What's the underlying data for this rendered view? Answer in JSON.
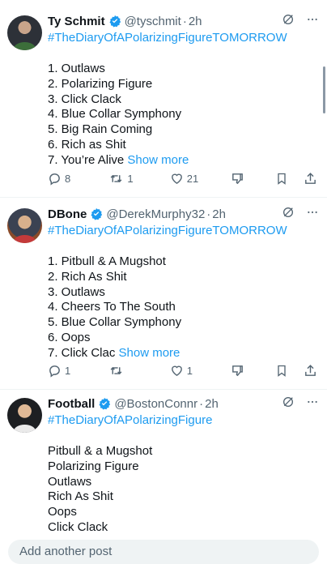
{
  "tweets": [
    {
      "name": "Ty Schmit",
      "handle": "@tyschmit",
      "time": "2h",
      "hashtag": "#TheDiaryOfAPolarizingFigureTOMORROW",
      "lines": [
        "1. Outlaws",
        "2. Polarizing Figure",
        "3. Click Clack",
        "4. Blue Collar Symphony",
        "5. Big Rain Coming",
        "6. Rich as Shit"
      ],
      "last_line": "7. You’re Alive ",
      "show_more": "Show more",
      "replies": "8",
      "retweets": "1",
      "likes": "21"
    },
    {
      "name": "DBone",
      "handle": "@DerekMurphy32",
      "time": "2h",
      "hashtag": "#TheDiaryOfAPolarizingFigureTOMORROW",
      "lines": [
        "1. Pitbull & A Mugshot",
        "2. Rich As Shit",
        "3. Outlaws",
        "4. Cheers To The South",
        "5. Blue Collar Symphony",
        "6. Oops"
      ],
      "last_line": "7.  Click Clac ",
      "show_more": "Show more",
      "replies": "1",
      "retweets": "",
      "likes": "1"
    },
    {
      "name": "Football",
      "handle": "@BostonConnr",
      "time": "2h",
      "hashtag": "#TheDiaryOfAPolarizingFigure",
      "lines": [
        "Pitbull & a Mugshot",
        "Polarizing Figure",
        "Outlaws",
        "Rich As Shit",
        "Oops",
        "Click Clack"
      ]
    }
  ],
  "reply_placeholder": "Add another post",
  "icons": {
    "verified": "verified-badge-icon",
    "grok": "grok-icon",
    "more": "more-icon",
    "reply": "reply-icon",
    "retweet": "retweet-icon",
    "like": "heart-icon",
    "dislike": "dislike-icon",
    "bookmark": "bookmark-icon",
    "share": "share-icon"
  },
  "colors": {
    "accent": "#1d9bf0",
    "muted": "#536471",
    "text": "#0f1419"
  }
}
